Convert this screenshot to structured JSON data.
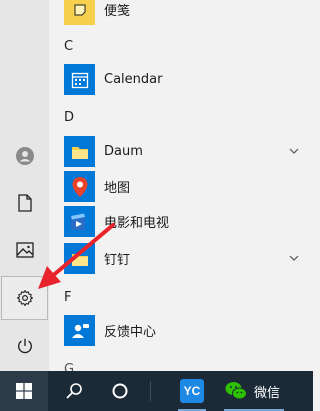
{
  "start_menu": {
    "rail": {
      "items": [
        {
          "name": "user-account",
          "icon": "user-avatar-icon"
        },
        {
          "name": "documents",
          "icon": "document-icon"
        },
        {
          "name": "pictures",
          "icon": "picture-icon"
        },
        {
          "name": "settings",
          "icon": "gear-icon",
          "active": true
        },
        {
          "name": "power",
          "icon": "power-icon"
        }
      ]
    },
    "app_list": {
      "top_item": {
        "label": "便笺",
        "icon": "sticky-notes-icon"
      },
      "sections": [
        {
          "letter": "C",
          "apps": [
            {
              "label": "Calendar",
              "icon": "calendar-icon"
            }
          ]
        },
        {
          "letter": "D",
          "apps": [
            {
              "label": "Daum",
              "icon": "folder-icon",
              "expandable": true
            },
            {
              "label": "地图",
              "icon": "map-pin-icon"
            },
            {
              "label": "电影和电视",
              "icon": "movies-tv-icon"
            },
            {
              "label": "钉钉",
              "icon": "folder-icon",
              "expandable": true
            }
          ]
        },
        {
          "letter": "F",
          "apps": [
            {
              "label": "反馈中心",
              "icon": "feedback-hub-icon"
            }
          ]
        },
        {
          "letter": "G",
          "apps": []
        }
      ]
    }
  },
  "taskbar": {
    "start_icon": "windows-logo-icon",
    "search_icon": "search-icon",
    "cortana_icon": "cortana-circle-icon",
    "pinned": [
      {
        "name": "yc-app",
        "icon": "yc-app-icon",
        "text": "YC"
      },
      {
        "name": "wechat",
        "icon": "wechat-icon",
        "label": "微信"
      }
    ]
  },
  "annotation": {
    "type": "red-arrow",
    "target": "settings"
  },
  "colors": {
    "tile_blue": "#0078d7",
    "folder_yellow": "#f6d04d",
    "taskbar_bg": "#1c2a38",
    "arrow_red": "#e8232b",
    "wechat_green": "#2dc100"
  }
}
